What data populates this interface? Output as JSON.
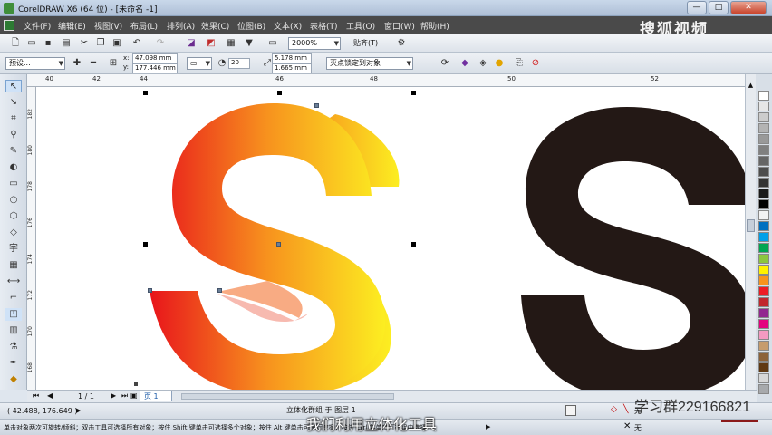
{
  "window": {
    "title": "CorelDRAW X6 (64 位) - [未命名 -1]",
    "minimize": "—",
    "maximize": "□",
    "close": "✕"
  },
  "watermark_brand": "搜狐视频",
  "menu": [
    "文件(F)",
    "编辑(E)",
    "视图(V)",
    "布局(L)",
    "排列(A)",
    "效果(C)",
    "位图(B)",
    "文本(X)",
    "表格(T)",
    "工具(O)",
    "窗口(W)",
    "帮助(H)"
  ],
  "standard_toolbar": {
    "zoom_value": "2000%",
    "snap_label": "贴齐(T)"
  },
  "property_bar": {
    "preset_value": "预设...",
    "x_label": "x:",
    "x_value": "47.098 mm",
    "y_label": "y:",
    "y_value": "177.446 mm",
    "depth_value": "20",
    "vp_x_value": "5.178 mm",
    "vp_y_value": "1.665 mm",
    "vanishing_point_value": "灭点锁定到对象"
  },
  "rulers": {
    "h_ticks": [
      "40",
      "42",
      "44",
      "46",
      "48",
      "50",
      "52"
    ],
    "v_ticks": [
      "182",
      "180",
      "178",
      "176",
      "174",
      "172",
      "170",
      "168"
    ]
  },
  "page_nav": {
    "page_count": "1 / 1",
    "page_tab": "页 1"
  },
  "status": {
    "object_info": "立体化群组 于 图层 1",
    "hint": "单击对象两次可旋转/倾斜；双击工具可选择所有对象；按住 Shift 键单击可选择多个对象；按住 Alt 键单击可进行挖掘；按住 Ctrl 并单击可在组中选择",
    "coordinates": "( 42.488, 176.649 )",
    "fill_none": "无",
    "outline_none": "无"
  },
  "overlay": {
    "qq_group": "学习群229166821",
    "subtitle": "我们利用立体化工具"
  },
  "colors": {
    "gradient_start": "#e8141b",
    "gradient_mid": "#f7921e",
    "gradient_end": "#fcee21",
    "black_letter": "#231815"
  },
  "palette": [
    "#ffffff",
    "#e6e6e6",
    "#cccccc",
    "#b3b3b3",
    "#999999",
    "#808080",
    "#666666",
    "#4d4d4d",
    "#333333",
    "#1a1a1a",
    "#000000",
    "#f2f2f2",
    "#0070c0",
    "#00a0e9",
    "#00a651",
    "#8dc63f",
    "#fff200",
    "#f7941d",
    "#ed1c24",
    "#c1272d",
    "#92278f",
    "#e4007f",
    "#f49ac1",
    "#c69c6d",
    "#8c6239",
    "#603913",
    "#d7d7d7",
    "#a7a9ac"
  ],
  "icons": {
    "tools": [
      "pick-tool-icon",
      "shape-tool-icon",
      "crop-tool-icon",
      "zoom-tool-icon",
      "freehand-tool-icon",
      "smart-fill-icon",
      "rectangle-tool-icon",
      "ellipse-tool-icon",
      "polygon-tool-icon",
      "text-tool-icon",
      "table-tool-icon",
      "dimension-tool-icon",
      "connector-tool-icon",
      "blend-tool-icon",
      "eyedropper-tool-icon",
      "outline-tool-icon",
      "fill-tool-icon",
      "interactive-fill-icon"
    ]
  }
}
